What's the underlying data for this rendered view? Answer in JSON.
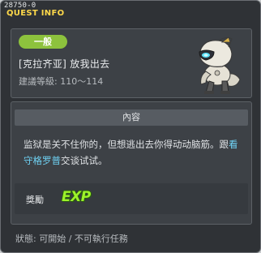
{
  "header": {
    "quest_id": "28750-0",
    "title": "QUEST INFO"
  },
  "quest": {
    "category_badge": "一般",
    "name": "[克拉齐亚] 放我出去",
    "level_requirement": "建議等級: 110～114",
    "npc_icon": "robot-npc-portrait"
  },
  "content": {
    "section_label": "內容",
    "description_part1": "监狱是关不住你的，但想逃出去你得动动脑筋。跟",
    "description_npc": "看守格罗普",
    "description_part2": "交谈试试。"
  },
  "reward": {
    "label": "獎勵",
    "icon_text": "EXP",
    "icon_name": "exp-icon"
  },
  "footer": {
    "status": "狀態:  可開始 / 不可執行任務"
  },
  "colors": {
    "accent_title": "#ffd94a",
    "badge": "#8dc23d",
    "npc_link": "#6fd3f5",
    "exp": "#9df22a"
  }
}
